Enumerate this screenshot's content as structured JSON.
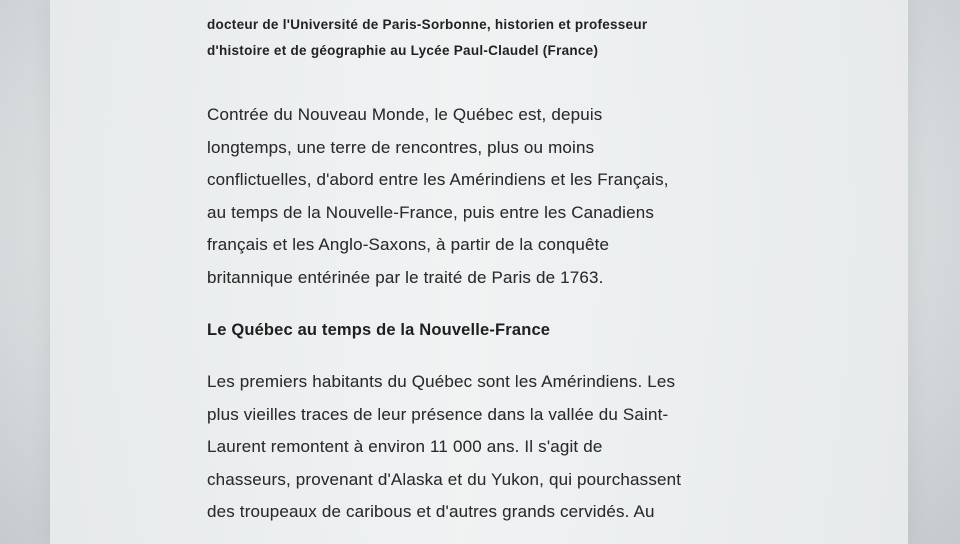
{
  "document": {
    "byline_lines": [
      "docteur de l'Université de Paris-Sorbonne, historien et professeur",
      "d'histoire et de géographie au Lycée Paul-Claudel (France)"
    ],
    "intro_lines": [
      "Contrée du Nouveau Monde, le Québec est, depuis",
      "longtemps, une terre de rencontres, plus ou moins",
      "conflictuelles, d'abord entre les Amérindiens et les Français,",
      "au temps de la Nouvelle-France, puis entre les Canadiens",
      "français et les Anglo-Saxons, à partir de la conquête",
      "britannique entérinée par le traité de Paris de 1763."
    ],
    "section_heading": "Le Québec au temps de la Nouvelle-France",
    "body_lines": [
      "Les premiers habitants du Québec sont les Amérindiens. Les",
      "plus vieilles traces de leur présence dans la vallée du Saint-",
      "Laurent remontent à environ 11 000 ans. Il s'agit de",
      "chasseurs, provenant d'Alaska et du Yukon, qui pourchassent",
      "des troupeaux de caribous et d'autres grands cervidés. Au"
    ]
  }
}
